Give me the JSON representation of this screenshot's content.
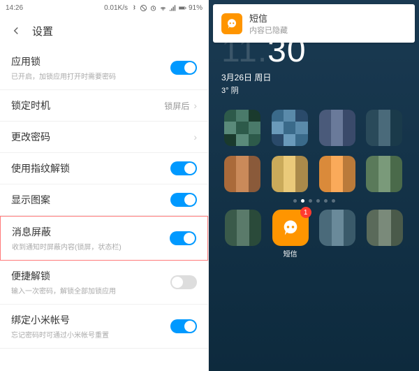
{
  "left": {
    "status": {
      "time": "14:26",
      "speed": "0.01K/s",
      "battery": "91%"
    },
    "header": {
      "title": "设置"
    },
    "rows": [
      {
        "title": "应用锁",
        "sub": "已开启，加锁应用打开时需要密码",
        "type": "toggle",
        "on": true
      },
      {
        "title": "锁定时机",
        "right_text": "锁屏后",
        "type": "link"
      },
      {
        "title": "更改密码",
        "type": "link"
      },
      {
        "title": "使用指纹解锁",
        "type": "toggle",
        "on": true
      },
      {
        "title": "显示图案",
        "type": "toggle",
        "on": true
      },
      {
        "title": "消息屏蔽",
        "sub": "收到通知时屏蔽内容(锁屏，状态栏)",
        "type": "toggle",
        "on": true,
        "highlight": true
      },
      {
        "title": "便捷解锁",
        "sub": "输入一次密码，解锁全部加锁应用",
        "type": "toggle",
        "on": false
      },
      {
        "title": "绑定小米帐号",
        "sub": "忘记密码时可通过小米帐号重置",
        "type": "toggle",
        "on": true
      }
    ]
  },
  "right": {
    "notification": {
      "app": "短信",
      "content": "内容已隐藏"
    },
    "clock": {
      "time_partial": "30",
      "date": "3月26日 周日",
      "weather": "3° 阴"
    },
    "page_dots": {
      "count": 6,
      "active": 1
    },
    "dock": {
      "sms_label": "短信",
      "sms_badge": "1"
    }
  }
}
